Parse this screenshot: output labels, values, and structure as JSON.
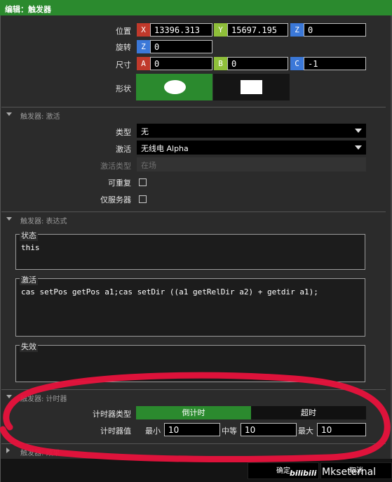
{
  "window": {
    "title": "编辑：触发器"
  },
  "transform": {
    "position_label": "位置",
    "rotation_label": "旋转",
    "size_label": "尺寸",
    "shape_label": "形状",
    "pos_x_axis": "X",
    "pos_x": "13396.313",
    "pos_y_axis": "Y",
    "pos_y": "15697.195",
    "pos_z_axis": "Z",
    "pos_z": "0",
    "rot_z_axis": "Z",
    "rot_z": "0",
    "size_a_axis": "A",
    "size_a": "0",
    "size_b_axis": "B",
    "size_b": "0",
    "size_c_axis": "C",
    "size_c": "-1",
    "shape_selected": "ellipse"
  },
  "activation": {
    "section_title": "触发器: 激活",
    "type_label": "类型",
    "type_value": "无",
    "activation_label": "激活",
    "activation_value": "无线电 Alpha",
    "activation_type_label": "激活类型",
    "activation_type_value": "在场",
    "repeatable_label": "可重复",
    "repeatable_checked": false,
    "server_only_label": "仅服务器",
    "server_only_checked": false
  },
  "expression": {
    "section_title": "触发器: 表达式",
    "condition_title": "状态",
    "condition_text": "this",
    "on_activation_title": "激活",
    "on_activation_text": "cas setPos getPos a1;cas setDir ((a1 getRelDir a2) + getdir a1);",
    "on_deactivation_title": "失效",
    "on_deactivation_text": ""
  },
  "timer": {
    "section_title": "触发器: 计时器",
    "type_label": "计时器类型",
    "option_countdown": "倒计时",
    "option_timeout": "超时",
    "selected": "倒计时",
    "values_label": "计时器值",
    "min_label": "最小",
    "min_value": "10",
    "mid_label": "中等",
    "mid_value": "10",
    "max_label": "最大",
    "max_value": "10"
  },
  "effects": {
    "section_title": "触发器: 效果"
  },
  "buttons": {
    "ok": "确定",
    "cancel": "取消"
  },
  "watermark": {
    "logo": "bilibili",
    "text": "Mkseternal"
  },
  "colors": {
    "accent": "#2b8a2e",
    "annotation": "#e8123c"
  }
}
